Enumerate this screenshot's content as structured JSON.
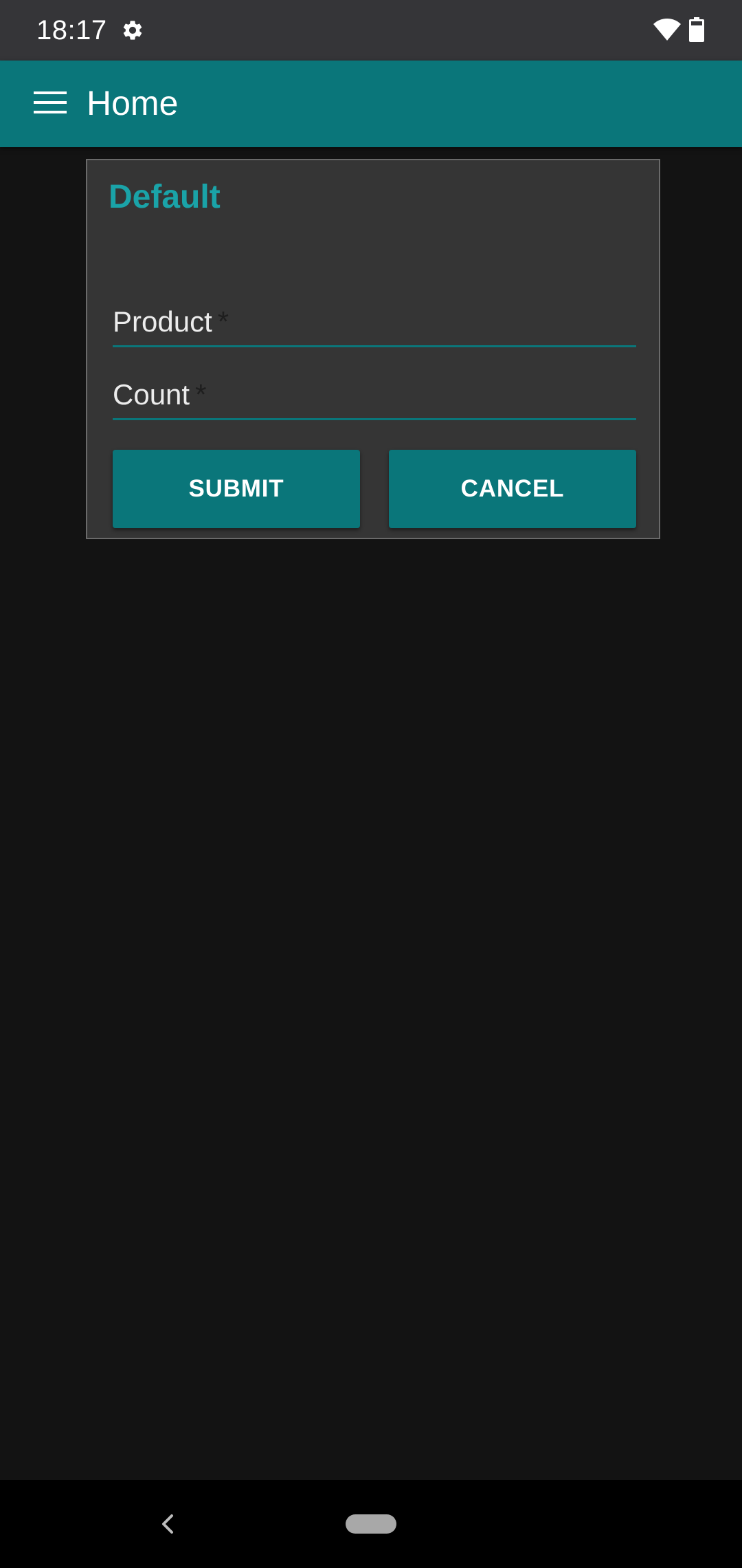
{
  "status_bar": {
    "time": "18:17",
    "icons": [
      "gear-icon",
      "wifi-icon",
      "battery-icon"
    ]
  },
  "app_bar": {
    "title": "Home",
    "menu_icon": "hamburger-menu-icon"
  },
  "dialog": {
    "title": "Default",
    "fields": [
      {
        "label": "Product",
        "required_mark": "*",
        "value": ""
      },
      {
        "label": "Count",
        "required_mark": "*",
        "value": ""
      }
    ],
    "submit_label": "SUBMIT",
    "cancel_label": "CANCEL"
  },
  "nav_bar": {
    "icons": [
      "back-icon",
      "home-pill-icon"
    ]
  },
  "colors": {
    "accent": "#0a767a",
    "title_accent": "#1aa3a8",
    "status_bar_bg": "#353538",
    "background": "#131313",
    "dialog_bg": "#353535"
  }
}
